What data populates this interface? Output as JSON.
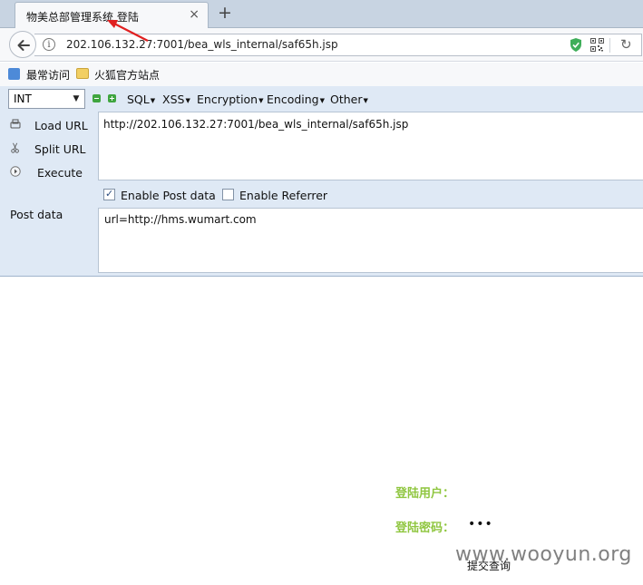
{
  "tab": {
    "title": "物美总部管理系统 登陆",
    "close": "×",
    "new_tab": "+"
  },
  "navbar": {
    "url": "202.106.132.27:7001/bea_wls_internal/saf65h.jsp",
    "info_icon": "i",
    "reload_icon": "↻"
  },
  "bookmarks": {
    "most_visited": "最常访问",
    "firefox_site": "火狐官方站点"
  },
  "hackbar": {
    "select_value": "INT",
    "menus": [
      "SQL",
      "XSS",
      "Encryption",
      "Encoding",
      "Other"
    ],
    "actions": {
      "load": "Load URL",
      "split": "Split URL",
      "execute": "Execute"
    },
    "url_value": "http://202.106.132.27:7001/bea_wls_internal/saf65h.jsp",
    "enable_post": {
      "label": "Enable Post data",
      "checked": true
    },
    "enable_referrer": {
      "label": "Enable Referrer",
      "checked": false
    },
    "post_label": "Post data",
    "post_value": "url=http://hms.wumart.com"
  },
  "page": {
    "user_label": "登陆用户：",
    "password_label": "登陆密码：",
    "password_value": "•••",
    "submit": "提交查询"
  },
  "watermark": "www.wooyun.org",
  "colors": {
    "label_green": "#8fc63f",
    "annotation_red": "#e02020"
  }
}
